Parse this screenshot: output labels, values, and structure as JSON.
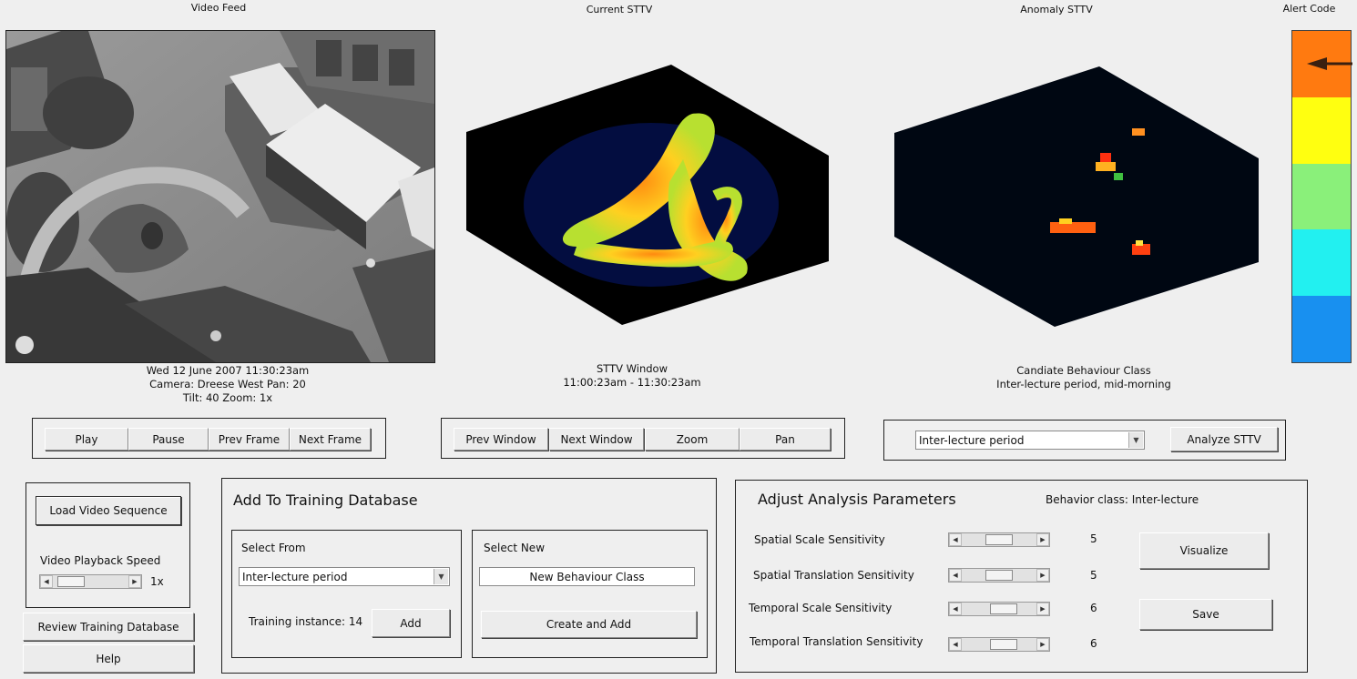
{
  "panels": {
    "video_title": "Video Feed",
    "current_title": "Current STTV",
    "anomaly_title": "Anomaly STTV",
    "alert_title": "Alert Code"
  },
  "video_info": [
    "Wed 12 June 2007 11:30:23am",
    "Camera: Dreese West Pan: 20",
    "Tilt: 40 Zoom: 1x"
  ],
  "sttv_info": [
    "STTV Window",
    "11:00:23am - 11:30:23am"
  ],
  "class_info": [
    "Candiate Behaviour Class",
    "Inter-lecture period, mid-morning"
  ],
  "alert_colors": [
    "#ff7a10",
    "#ffff10",
    "#8af07a",
    "#22f0f0",
    "#1890f0"
  ],
  "alert_level": 0,
  "playback": {
    "play": "Play",
    "pause": "Pause",
    "prev_frame": "Prev Frame",
    "next_frame": "Next Frame"
  },
  "window_ctrl": {
    "prev_window": "Prev Window",
    "next_window": "Next Window",
    "zoom": "Zoom",
    "pan": "Pan"
  },
  "analyze": {
    "selected_class": "Inter-lecture period",
    "button": "Analyze STTV"
  },
  "load": {
    "button": "Load Video Sequence",
    "speed_label": "Video Playback Speed",
    "speed_value": "1x",
    "speed_fraction": 0.1
  },
  "review_button": "Review Training Database",
  "help_button": "Help",
  "training": {
    "title": "Add To Training Database",
    "select_from": "Select From",
    "selected": "Inter-lecture period",
    "instance_label": "Training instance: 14",
    "add": "Add",
    "select_new": "Select New",
    "new_value": "New Behaviour Class",
    "create_add": "Create and Add"
  },
  "params": {
    "title": "Adjust Analysis Parameters",
    "behavior_class": "Behavior class: Inter-lecture",
    "sliders": [
      {
        "label": "Spatial Scale Sensitivity",
        "value": "5",
        "fraction": 0.5
      },
      {
        "label": "Spatial Translation Sensitivity",
        "value": "5",
        "fraction": 0.5
      },
      {
        "label": "Temporal Scale Sensitivity",
        "value": "6",
        "fraction": 0.6
      },
      {
        "label": "Temporal Translation Sensitivity",
        "value": "6",
        "fraction": 0.6
      }
    ],
    "visualize": "Visualize",
    "save": "Save"
  }
}
